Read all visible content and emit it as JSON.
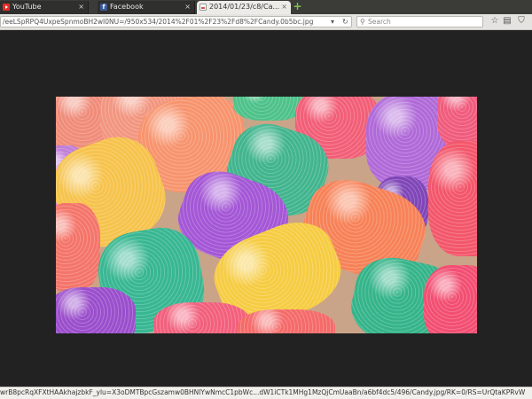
{
  "tabs": [
    {
      "title": "YouTube",
      "close": "×",
      "icon": "youtube-icon"
    },
    {
      "title": "Facebook",
      "close": "×",
      "icon": "facebook-icon"
    },
    {
      "title": "2014/01/23/c8/Ca...",
      "close": "×",
      "icon": "image-file-icon"
    }
  ],
  "new_tab": "+",
  "address": {
    "url": "/eeLSpRPQ4UxpeSpnmoBH2wI0NU=/950x534/2014%2F01%2F23%2Fd8%2FCandy.0b5bc.jpg",
    "dropdown": "▾",
    "reload": "↻"
  },
  "search": {
    "placeholder": "Search",
    "icon": "search-icon"
  },
  "toolbar": {
    "bookmark": "☆",
    "reading": "▤",
    "pocket": "⛉"
  },
  "status": {
    "text": "wrB8pcRqXFXtHAAkhajzbkF_ylu=X3oDMTBpcGszamw0BHNlYwNmcC1pbWc...dW1iCTk1MHg1MzQjCmUaaBn/a6bf4dc5/496/Candy.jpg/RK=0/RS=UrQtaKPRvW"
  },
  "colors": {
    "background": "#232323",
    "tab_active": "#ecebe8",
    "navbar": "#e4e3df"
  }
}
